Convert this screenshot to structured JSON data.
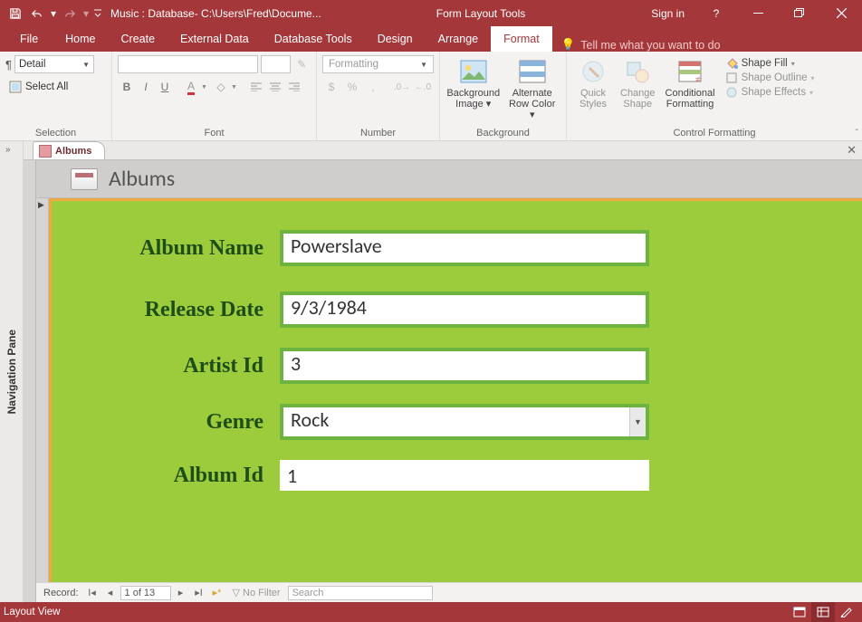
{
  "titlebar": {
    "db_title": "Music : Database- C:\\Users\\Fred\\Docume...",
    "context_title": "Form Layout Tools",
    "signin": "Sign in"
  },
  "tabs": {
    "file": "File",
    "home": "Home",
    "create": "Create",
    "external": "External Data",
    "dbtools": "Database Tools",
    "design": "Design",
    "arrange": "Arrange",
    "format": "Format",
    "tellme": "Tell me what you want to do"
  },
  "ribbon": {
    "selection": {
      "object": "Detail",
      "select_all": "Select All",
      "group": "Selection"
    },
    "font": {
      "group": "Font"
    },
    "number": {
      "format_combo": "Formatting",
      "group": "Number"
    },
    "background": {
      "bgimage": "Background\nImage",
      "altrow": "Alternate\nRow Color",
      "group": "Background"
    },
    "ctrlfmt": {
      "quick": "Quick\nStyles",
      "change": "Change\nShape",
      "cond": "Conditional\nFormatting",
      "fill": "Shape Fill",
      "outline": "Shape Outline",
      "effects": "Shape Effects",
      "group": "Control Formatting"
    }
  },
  "nav_pane": "Navigation Pane",
  "doc_tab": "Albums",
  "form": {
    "title": "Albums",
    "labels": {
      "album_name": "Album Name",
      "release_date": "Release Date",
      "artist_id": "Artist Id",
      "genre": "Genre",
      "album_id": "Album Id"
    },
    "values": {
      "album_name": "Powerslave",
      "release_date": "9/3/1984",
      "artist_id": "3",
      "genre": "Rock",
      "album_id": "1"
    }
  },
  "recordnav": {
    "label": "Record:",
    "counter": "1 of 13",
    "nofilter": "No Filter",
    "search": "Search"
  },
  "statusbar": {
    "view": "Layout View"
  }
}
